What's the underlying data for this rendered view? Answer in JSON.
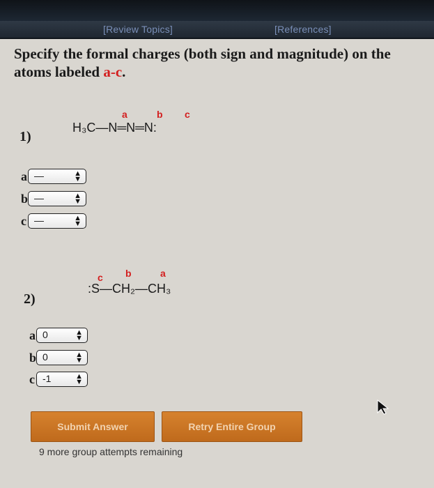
{
  "nav": {
    "review_topics": "[Review Topics]",
    "references": "[References]"
  },
  "question": {
    "text_main": "Specify the formal charges (both sign and magnitude) on the atoms labeled ",
    "text_red": "a-c",
    "text_end": "."
  },
  "problem1": {
    "number": "1)",
    "molecule": "H₃C—N═N═N:",
    "labels": {
      "a": "a",
      "b": "b",
      "c": "c"
    },
    "answers": [
      {
        "letter": "a",
        "value": "—"
      },
      {
        "letter": "b",
        "value": "—"
      },
      {
        "letter": "c",
        "value": "—"
      }
    ]
  },
  "problem2": {
    "number": "2)",
    "molecule": ":S—CH₂—CH₃",
    "labels": {
      "a": "a",
      "b": "b",
      "c": "c"
    },
    "answers": [
      {
        "letter": "a",
        "value": "0"
      },
      {
        "letter": "b",
        "value": "0"
      },
      {
        "letter": "c",
        "value": "-1"
      }
    ]
  },
  "buttons": {
    "submit": "Submit Answer",
    "retry": "Retry Entire Group"
  },
  "status": {
    "attempts": "9 more group attempts remaining"
  },
  "colors": {
    "accent_orange": "#c8731f",
    "label_red": "#d31f1f",
    "nav_link": "#7a8fb8"
  }
}
